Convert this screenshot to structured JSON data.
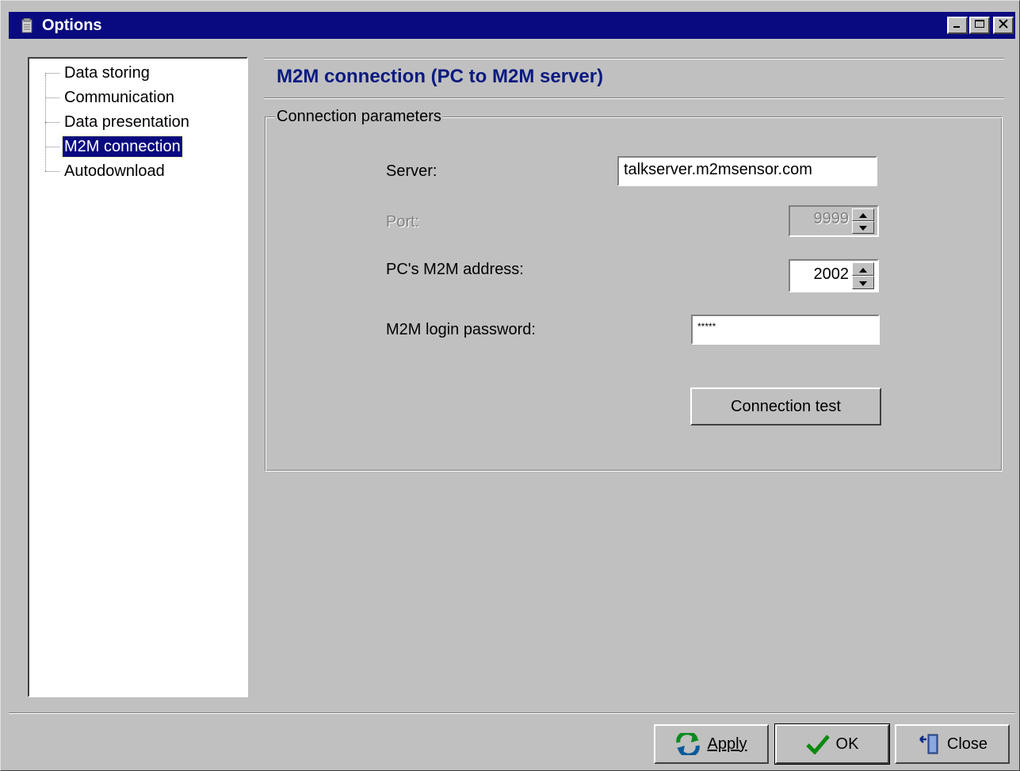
{
  "window": {
    "title": "Options"
  },
  "titlebar_buttons": {
    "minimize": "minimize-icon",
    "maximize": "maximize-icon",
    "close": "close-icon"
  },
  "tree": {
    "items": [
      {
        "label": "Data storing",
        "selected": false
      },
      {
        "label": "Communication",
        "selected": false
      },
      {
        "label": "Data presentation",
        "selected": false
      },
      {
        "label": "M2M connection",
        "selected": true
      },
      {
        "label": "Autodownload",
        "selected": false
      }
    ]
  },
  "section": {
    "title": "M2M connection (PC to M2M server)"
  },
  "group": {
    "legend": "Connection parameters"
  },
  "fields": {
    "server_label": "Server:",
    "server_value": "talkserver.m2msensor.com",
    "port_label": "Port:",
    "port_value": "9999",
    "address_label": "PC's M2M address:",
    "address_value": "2002",
    "password_label": "M2M login password:",
    "password_value": "*****"
  },
  "buttons": {
    "connection_test": "Connection test",
    "apply": "Apply",
    "ok": "OK",
    "close": "Close"
  },
  "colors": {
    "titlebar": "#0a0a80",
    "face": "#c0c0c0",
    "section_title": "#0a1a80"
  }
}
